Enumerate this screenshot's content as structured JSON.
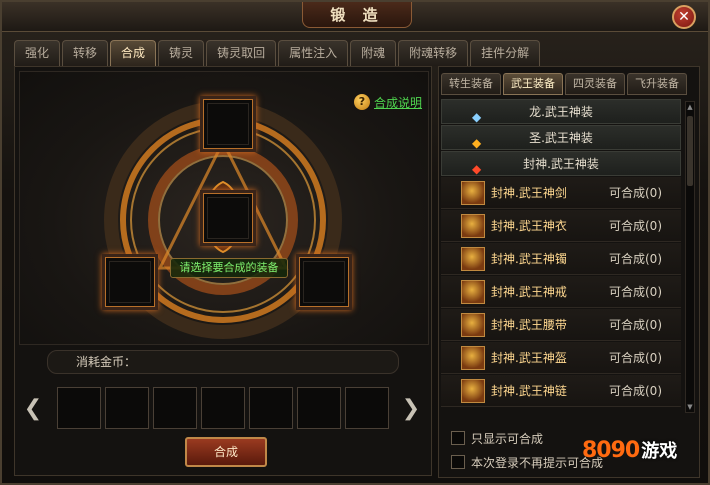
{
  "window": {
    "title": "锻 造",
    "close_label": "✕"
  },
  "tabs": [
    {
      "label": "强化"
    },
    {
      "label": "转移"
    },
    {
      "label": "合成",
      "active": true
    },
    {
      "label": "铸灵"
    },
    {
      "label": "铸灵取回"
    },
    {
      "label": "属性注入"
    },
    {
      "label": "附魂"
    },
    {
      "label": "附魂转移"
    },
    {
      "label": "挂件分解"
    }
  ],
  "forge": {
    "help_icon": "?",
    "help_link": "合成说明",
    "hint": "请选择要合成的装备",
    "cost_label": "消耗金币：",
    "prev_arrow": "❮",
    "next_arrow": "❯",
    "compose_button": "合成"
  },
  "right": {
    "subtabs": [
      {
        "label": "转生装备"
      },
      {
        "label": "武王装备",
        "active": true
      },
      {
        "label": "四灵装备"
      },
      {
        "label": "飞升装备"
      }
    ],
    "categories": [
      {
        "label": "龙.武王神装",
        "icon": "diamond-gem-icon",
        "glyph": "◆",
        "color": "#8ad0ff"
      },
      {
        "label": "圣.武王神装",
        "icon": "gold-gem-icon",
        "glyph": "◆",
        "color": "#ffb020"
      },
      {
        "label": "封神.武王神装",
        "icon": "red-gem-icon",
        "glyph": "◆",
        "color": "#ff4a2a"
      }
    ],
    "items": [
      {
        "name": "封神.武王神剑",
        "status": "可合成(0)"
      },
      {
        "name": "封神.武王神衣",
        "status": "可合成(0)"
      },
      {
        "name": "封神.武王神镯",
        "status": "可合成(0)"
      },
      {
        "name": "封神.武王神戒",
        "status": "可合成(0)"
      },
      {
        "name": "封神.武王腰带",
        "status": "可合成(0)"
      },
      {
        "name": "封神.武王神盔",
        "status": "可合成(0)"
      },
      {
        "name": "封神.武王神链",
        "status": "可合成(0)"
      }
    ],
    "checkboxes": [
      {
        "label": "只显示可合成"
      },
      {
        "label": "本次登录不再提示可合成"
      }
    ]
  },
  "watermark": {
    "text": "8090",
    "sub": "游戏"
  }
}
